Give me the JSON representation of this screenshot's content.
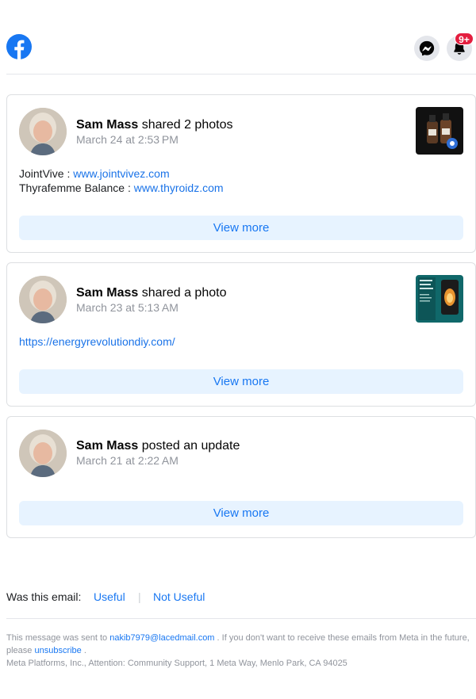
{
  "header": {
    "logo_icon": "facebook-logo-icon",
    "messenger_icon": "messenger-icon",
    "notifications_icon": "bell-icon",
    "notification_badge": "9+"
  },
  "posts": [
    {
      "name": "Sam Mass",
      "action": "shared 2 photos",
      "date": "March 24 at 2:53 PM",
      "lines": [
        {
          "label": "JointVive : ",
          "link": "www.jointvivez.com"
        },
        {
          "label": "Thyrafemme Balance : ",
          "link": "www.thyroidz.com"
        }
      ],
      "button": "View more"
    },
    {
      "name": "Sam Mass",
      "action": "shared a photo",
      "date": "March 23 at 5:13 AM",
      "lines": [
        {
          "label": "",
          "link": "https://energyrevolutiondiy.com/"
        }
      ],
      "button": "View more"
    },
    {
      "name": "Sam Mass",
      "action": "posted an update",
      "date": "March 21 at 2:22 AM",
      "lines": [],
      "button": "View more"
    }
  ],
  "feedback": {
    "question": "Was this email:",
    "useful": "Useful",
    "separator": "|",
    "not_useful": "Not Useful"
  },
  "footer": {
    "sent_to_prefix": "This message was sent to ",
    "email": "nakib7979@lacedmail.com",
    "sent_to_suffix": " . If you don't want to receive these emails from Meta in the future, please ",
    "unsubscribe": "unsubscribe",
    "period": " .",
    "address": "Meta Platforms, Inc., Attention: Community Support, 1 Meta Way, Menlo Park, CA 94025"
  },
  "colors": {
    "brand_blue": "#1877f2",
    "badge_red": "#e41e3f",
    "button_bg": "#e7f3ff"
  }
}
